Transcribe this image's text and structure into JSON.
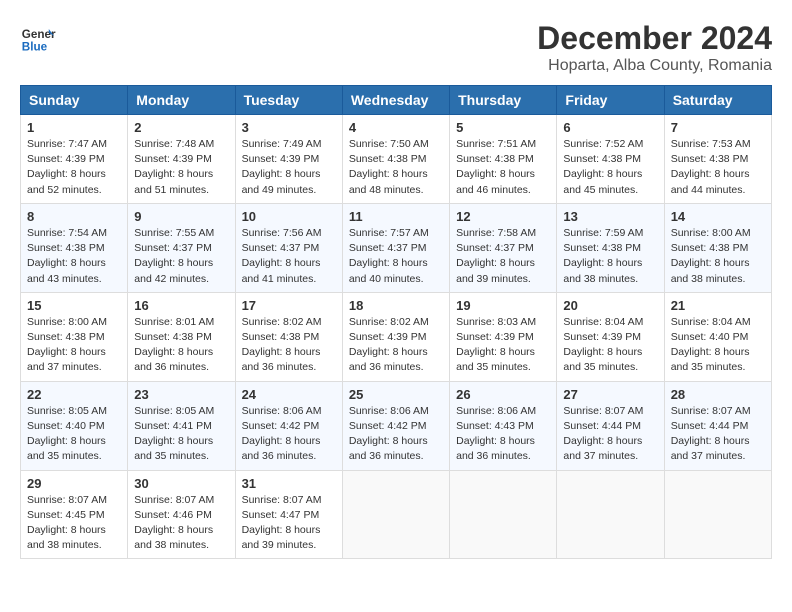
{
  "logo": {
    "text_general": "General",
    "text_blue": "Blue"
  },
  "title": "December 2024",
  "subtitle": "Hoparta, Alba County, Romania",
  "weekdays": [
    "Sunday",
    "Monday",
    "Tuesday",
    "Wednesday",
    "Thursday",
    "Friday",
    "Saturday"
  ],
  "weeks": [
    [
      {
        "day": "1",
        "sunrise": "7:47 AM",
        "sunset": "4:39 PM",
        "daylight": "8 hours and 52 minutes."
      },
      {
        "day": "2",
        "sunrise": "7:48 AM",
        "sunset": "4:39 PM",
        "daylight": "8 hours and 51 minutes."
      },
      {
        "day": "3",
        "sunrise": "7:49 AM",
        "sunset": "4:39 PM",
        "daylight": "8 hours and 49 minutes."
      },
      {
        "day": "4",
        "sunrise": "7:50 AM",
        "sunset": "4:38 PM",
        "daylight": "8 hours and 48 minutes."
      },
      {
        "day": "5",
        "sunrise": "7:51 AM",
        "sunset": "4:38 PM",
        "daylight": "8 hours and 46 minutes."
      },
      {
        "day": "6",
        "sunrise": "7:52 AM",
        "sunset": "4:38 PM",
        "daylight": "8 hours and 45 minutes."
      },
      {
        "day": "7",
        "sunrise": "7:53 AM",
        "sunset": "4:38 PM",
        "daylight": "8 hours and 44 minutes."
      }
    ],
    [
      {
        "day": "8",
        "sunrise": "7:54 AM",
        "sunset": "4:38 PM",
        "daylight": "8 hours and 43 minutes."
      },
      {
        "day": "9",
        "sunrise": "7:55 AM",
        "sunset": "4:37 PM",
        "daylight": "8 hours and 42 minutes."
      },
      {
        "day": "10",
        "sunrise": "7:56 AM",
        "sunset": "4:37 PM",
        "daylight": "8 hours and 41 minutes."
      },
      {
        "day": "11",
        "sunrise": "7:57 AM",
        "sunset": "4:37 PM",
        "daylight": "8 hours and 40 minutes."
      },
      {
        "day": "12",
        "sunrise": "7:58 AM",
        "sunset": "4:37 PM",
        "daylight": "8 hours and 39 minutes."
      },
      {
        "day": "13",
        "sunrise": "7:59 AM",
        "sunset": "4:38 PM",
        "daylight": "8 hours and 38 minutes."
      },
      {
        "day": "14",
        "sunrise": "8:00 AM",
        "sunset": "4:38 PM",
        "daylight": "8 hours and 38 minutes."
      }
    ],
    [
      {
        "day": "15",
        "sunrise": "8:00 AM",
        "sunset": "4:38 PM",
        "daylight": "8 hours and 37 minutes."
      },
      {
        "day": "16",
        "sunrise": "8:01 AM",
        "sunset": "4:38 PM",
        "daylight": "8 hours and 36 minutes."
      },
      {
        "day": "17",
        "sunrise": "8:02 AM",
        "sunset": "4:38 PM",
        "daylight": "8 hours and 36 minutes."
      },
      {
        "day": "18",
        "sunrise": "8:02 AM",
        "sunset": "4:39 PM",
        "daylight": "8 hours and 36 minutes."
      },
      {
        "day": "19",
        "sunrise": "8:03 AM",
        "sunset": "4:39 PM",
        "daylight": "8 hours and 35 minutes."
      },
      {
        "day": "20",
        "sunrise": "8:04 AM",
        "sunset": "4:39 PM",
        "daylight": "8 hours and 35 minutes."
      },
      {
        "day": "21",
        "sunrise": "8:04 AM",
        "sunset": "4:40 PM",
        "daylight": "8 hours and 35 minutes."
      }
    ],
    [
      {
        "day": "22",
        "sunrise": "8:05 AM",
        "sunset": "4:40 PM",
        "daylight": "8 hours and 35 minutes."
      },
      {
        "day": "23",
        "sunrise": "8:05 AM",
        "sunset": "4:41 PM",
        "daylight": "8 hours and 35 minutes."
      },
      {
        "day": "24",
        "sunrise": "8:06 AM",
        "sunset": "4:42 PM",
        "daylight": "8 hours and 36 minutes."
      },
      {
        "day": "25",
        "sunrise": "8:06 AM",
        "sunset": "4:42 PM",
        "daylight": "8 hours and 36 minutes."
      },
      {
        "day": "26",
        "sunrise": "8:06 AM",
        "sunset": "4:43 PM",
        "daylight": "8 hours and 36 minutes."
      },
      {
        "day": "27",
        "sunrise": "8:07 AM",
        "sunset": "4:44 PM",
        "daylight": "8 hours and 37 minutes."
      },
      {
        "day": "28",
        "sunrise": "8:07 AM",
        "sunset": "4:44 PM",
        "daylight": "8 hours and 37 minutes."
      }
    ],
    [
      {
        "day": "29",
        "sunrise": "8:07 AM",
        "sunset": "4:45 PM",
        "daylight": "8 hours and 38 minutes."
      },
      {
        "day": "30",
        "sunrise": "8:07 AM",
        "sunset": "4:46 PM",
        "daylight": "8 hours and 38 minutes."
      },
      {
        "day": "31",
        "sunrise": "8:07 AM",
        "sunset": "4:47 PM",
        "daylight": "8 hours and 39 minutes."
      },
      null,
      null,
      null,
      null
    ]
  ],
  "labels": {
    "sunrise": "Sunrise:",
    "sunset": "Sunset:",
    "daylight": "Daylight:"
  }
}
